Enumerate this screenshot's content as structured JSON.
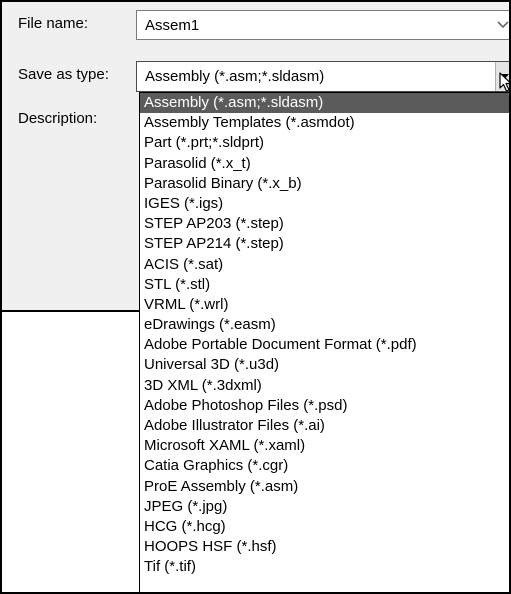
{
  "labels": {
    "file_name": "File name:",
    "save_as_type": "Save as type:",
    "description": "Description:"
  },
  "file_name_value": "Assem1",
  "save_as_type_value": "Assembly (*.asm;*.sldasm)",
  "icons": {
    "combo_arrow": "chevron-down-icon",
    "cursor": "mouse-pointer-icon"
  },
  "colors": {
    "selected_bg": "#5b5b5b",
    "dialog_bg": "#f0f0f0"
  },
  "options": [
    "Assembly (*.asm;*.sldasm)",
    "Assembly Templates (*.asmdot)",
    "Part (*.prt;*.sldprt)",
    "Parasolid (*.x_t)",
    "Parasolid Binary (*.x_b)",
    "IGES (*.igs)",
    "STEP AP203 (*.step)",
    "STEP AP214 (*.step)",
    "ACIS (*.sat)",
    "STL (*.stl)",
    "VRML (*.wrl)",
    "eDrawings (*.easm)",
    "Adobe Portable Document Format (*.pdf)",
    "Universal 3D (*.u3d)",
    "3D XML (*.3dxml)",
    "Adobe Photoshop Files  (*.psd)",
    "Adobe Illustrator Files (*.ai)",
    "Microsoft XAML (*.xaml)",
    "Catia Graphics (*.cgr)",
    "ProE Assembly (*.asm)",
    "JPEG (*.jpg)",
    "HCG (*.hcg)",
    "HOOPS HSF (*.hsf)",
    "Tif (*.tif)"
  ],
  "selected_index": 0
}
